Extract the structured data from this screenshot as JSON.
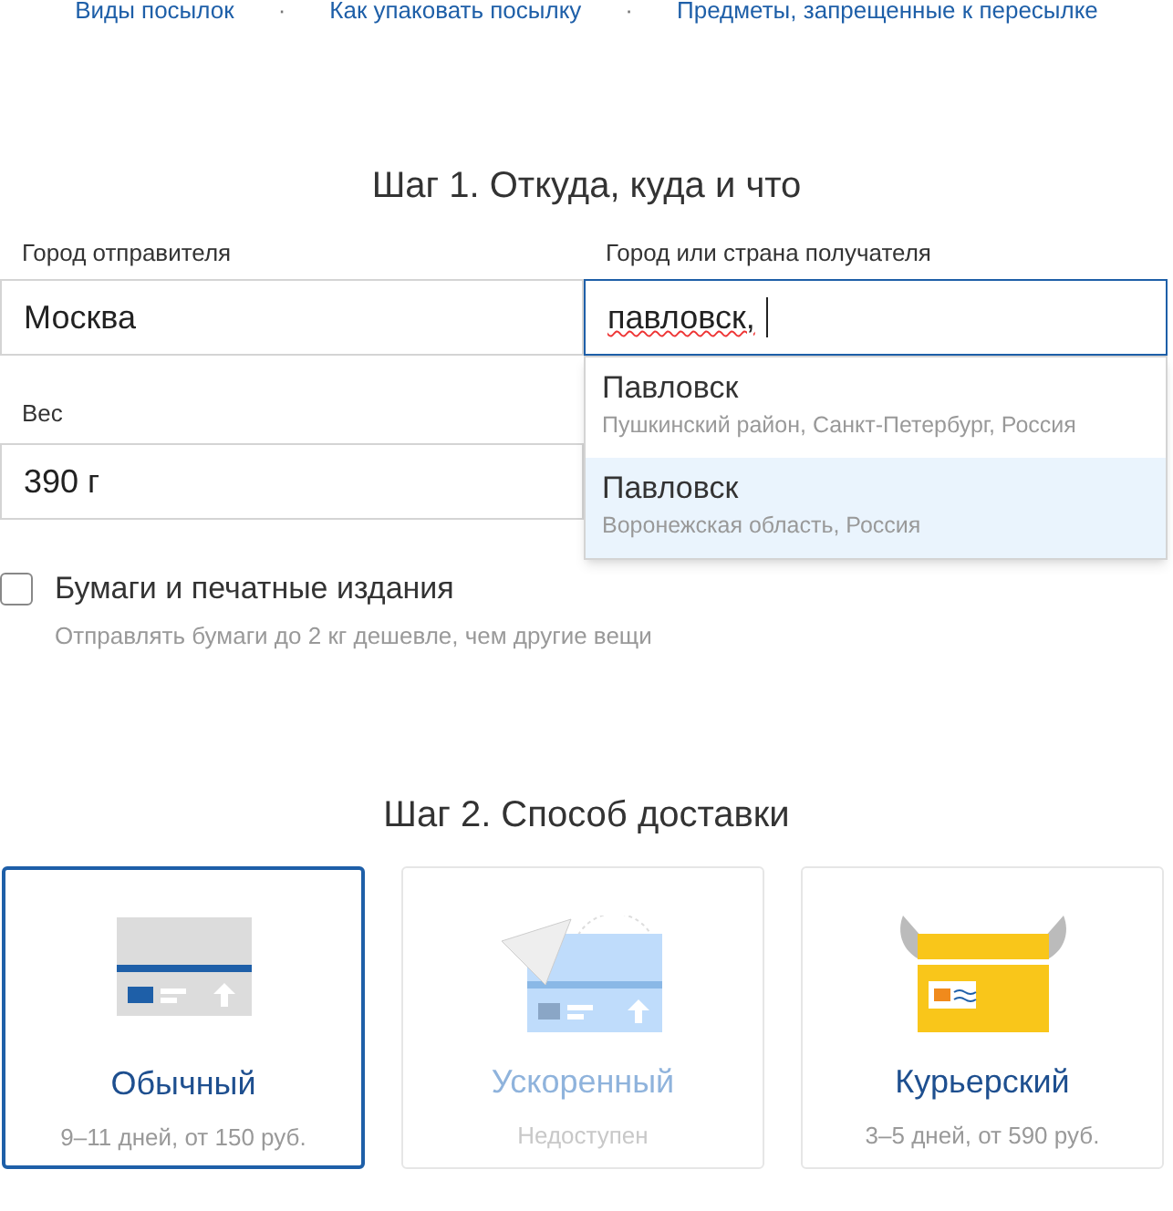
{
  "links": [
    {
      "label": "Виды посылок"
    },
    {
      "label": "Как упаковать посылку"
    },
    {
      "label": "Предметы, запрещенные к пересылке"
    }
  ],
  "link_separator": "·",
  "step1": {
    "title": "Шаг 1. Откуда, куда и что",
    "sender": {
      "label": "Город отправителя",
      "value": "Москва"
    },
    "recipient": {
      "label": "Город или страна получателя",
      "value": "павловск,",
      "focused": true,
      "suggestions": [
        {
          "name": "Павловск",
          "detail": "Пушкинский район, Санкт-Петербург, Россия",
          "selected": false
        },
        {
          "name": "Павловск",
          "detail": "Воронежская область, Россия",
          "selected": true
        }
      ]
    },
    "weight": {
      "label": "Вес",
      "value": "390 г"
    },
    "papers": {
      "label": "Бумаги и печатные издания",
      "checked": false,
      "hint": "Отправлять бумаги до 2 кг дешевле, чем другие вещи"
    }
  },
  "step2": {
    "title": "Шаг 2. Способ доставки",
    "options": [
      {
        "kind": "standard",
        "name": "Обычный",
        "detail": "9–11 дней, от 150 руб.",
        "selected": true,
        "disabled": false
      },
      {
        "kind": "express",
        "name": "Ускоренный",
        "detail": "Недоступен",
        "selected": false,
        "disabled": true
      },
      {
        "kind": "courier",
        "name": "Курьерский",
        "detail": "3–5 дней, от 590 руб.",
        "selected": false,
        "disabled": false
      }
    ]
  }
}
